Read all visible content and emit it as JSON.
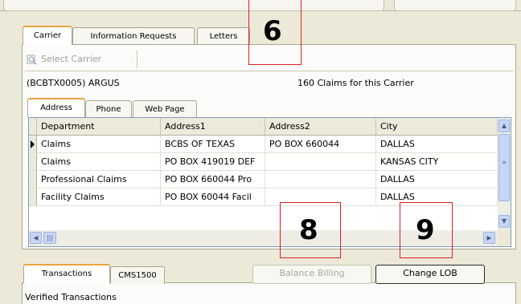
{
  "top_tabs": [
    "Carrier",
    "Information Requests",
    "Letters"
  ],
  "select_carrier": {
    "label": "Select Carrier"
  },
  "carrier_name": "(BCBTX0005) ARGUS",
  "claims_count": "160 Claims for this Carrier",
  "sub_tabs": [
    "Address",
    "Phone",
    "Web Page"
  ],
  "table": {
    "columns": [
      "Department",
      "Address1",
      "Address2",
      "City"
    ],
    "rows": [
      [
        "Claims",
        "BCBS OF TEXAS",
        "PO BOX 660044",
        "DALLAS"
      ],
      [
        "Claims",
        "PO BOX 419019 DEF",
        "",
        "KANSAS CITY"
      ],
      [
        "Professional Claims",
        "PO BOX 660044 Pro",
        "",
        "DALLAS"
      ],
      [
        "Facility Claims",
        "PO BOX 60044 Facil",
        "",
        "DALLAS"
      ]
    ],
    "selected_row": 0
  },
  "bottom_tabs": [
    "Transactions",
    "CMS1500"
  ],
  "balance_billing_label": "Balance Billing",
  "change_lob_label": "Change LOB",
  "verified_label": "Verified Transactions",
  "annotations": [
    "6",
    "8",
    "9"
  ],
  "colors": {
    "annotation": "#e02020",
    "active_tab_accent": "#e8a33a"
  }
}
